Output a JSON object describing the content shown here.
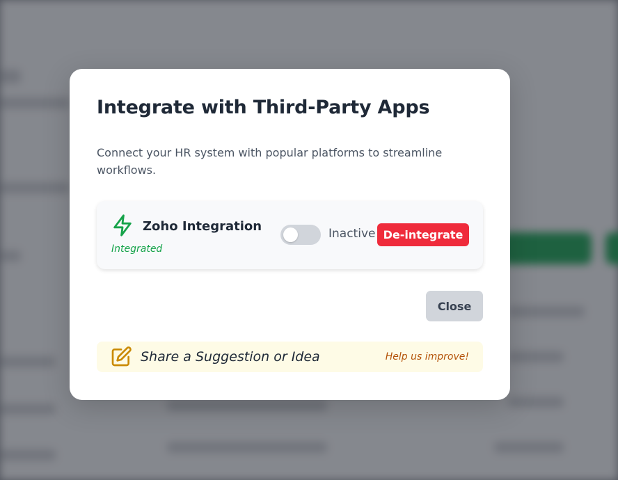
{
  "modal": {
    "title": "Integrate with Third-Party Apps",
    "description": "Connect your HR system with popular platforms to streamline workflows."
  },
  "integration": {
    "name": "Zoho Integration",
    "status": "Integrated",
    "toggle_state": "Inactive",
    "toggle_on": false,
    "deintegrate_label": "De-integrate",
    "icon": "bolt-icon",
    "accent_color": "#16a34a",
    "danger_color": "#ef2b3b"
  },
  "actions": {
    "close_label": "Close"
  },
  "suggestion": {
    "label": "Share a Suggestion or Idea",
    "hint": "Help us improve!",
    "icon": "edit-icon"
  }
}
